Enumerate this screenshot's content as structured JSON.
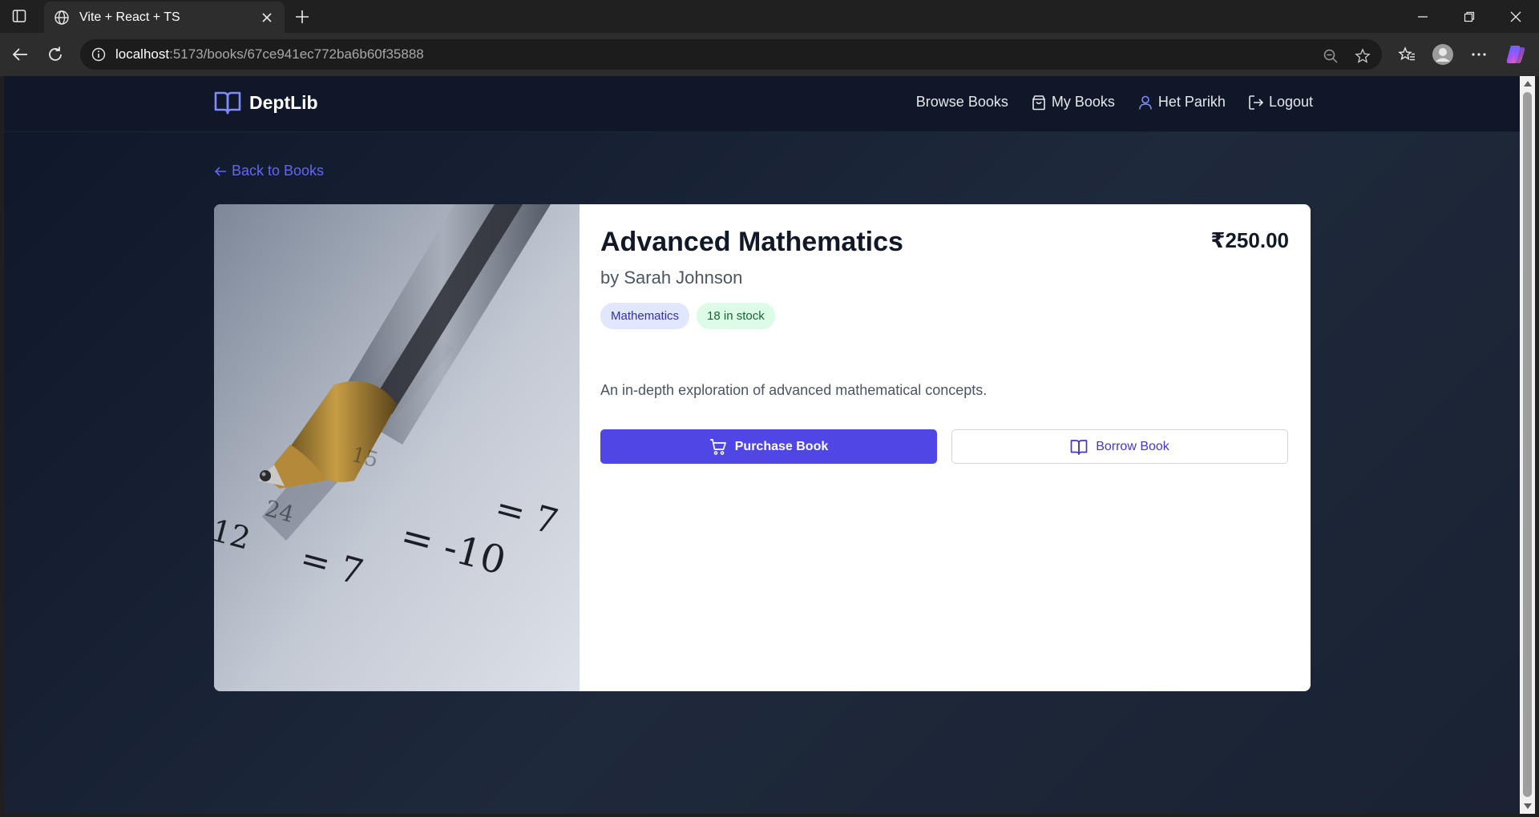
{
  "browser": {
    "tab_title": "Vite + React + TS",
    "url_host": "localhost",
    "url_path": ":5173/books/67ce941ec772ba6b60f35888"
  },
  "header": {
    "brand": "DeptLib",
    "nav": {
      "browse": "Browse Books",
      "my_books": "My Books",
      "user": "Het Parikh",
      "logout": "Logout"
    }
  },
  "back_link": "Back to Books",
  "book": {
    "title": "Advanced Mathematics",
    "author": "by Sarah Johnson",
    "price": "₹250.00",
    "category": "Mathematics",
    "stock": "18 in stock",
    "description": "An in-depth exploration of advanced mathematical concepts.",
    "purchase_label": "Purchase Book",
    "borrow_label": "Borrow Book",
    "cover_texts": [
      "= 7",
      "= -10",
      "= 7",
      "12",
      "24",
      "15"
    ]
  },
  "colors": {
    "accent": "#4f46e5",
    "page_bg": "#0f172a",
    "category_badge": "#e0e7ff",
    "stock_badge": "#dcfce7"
  }
}
